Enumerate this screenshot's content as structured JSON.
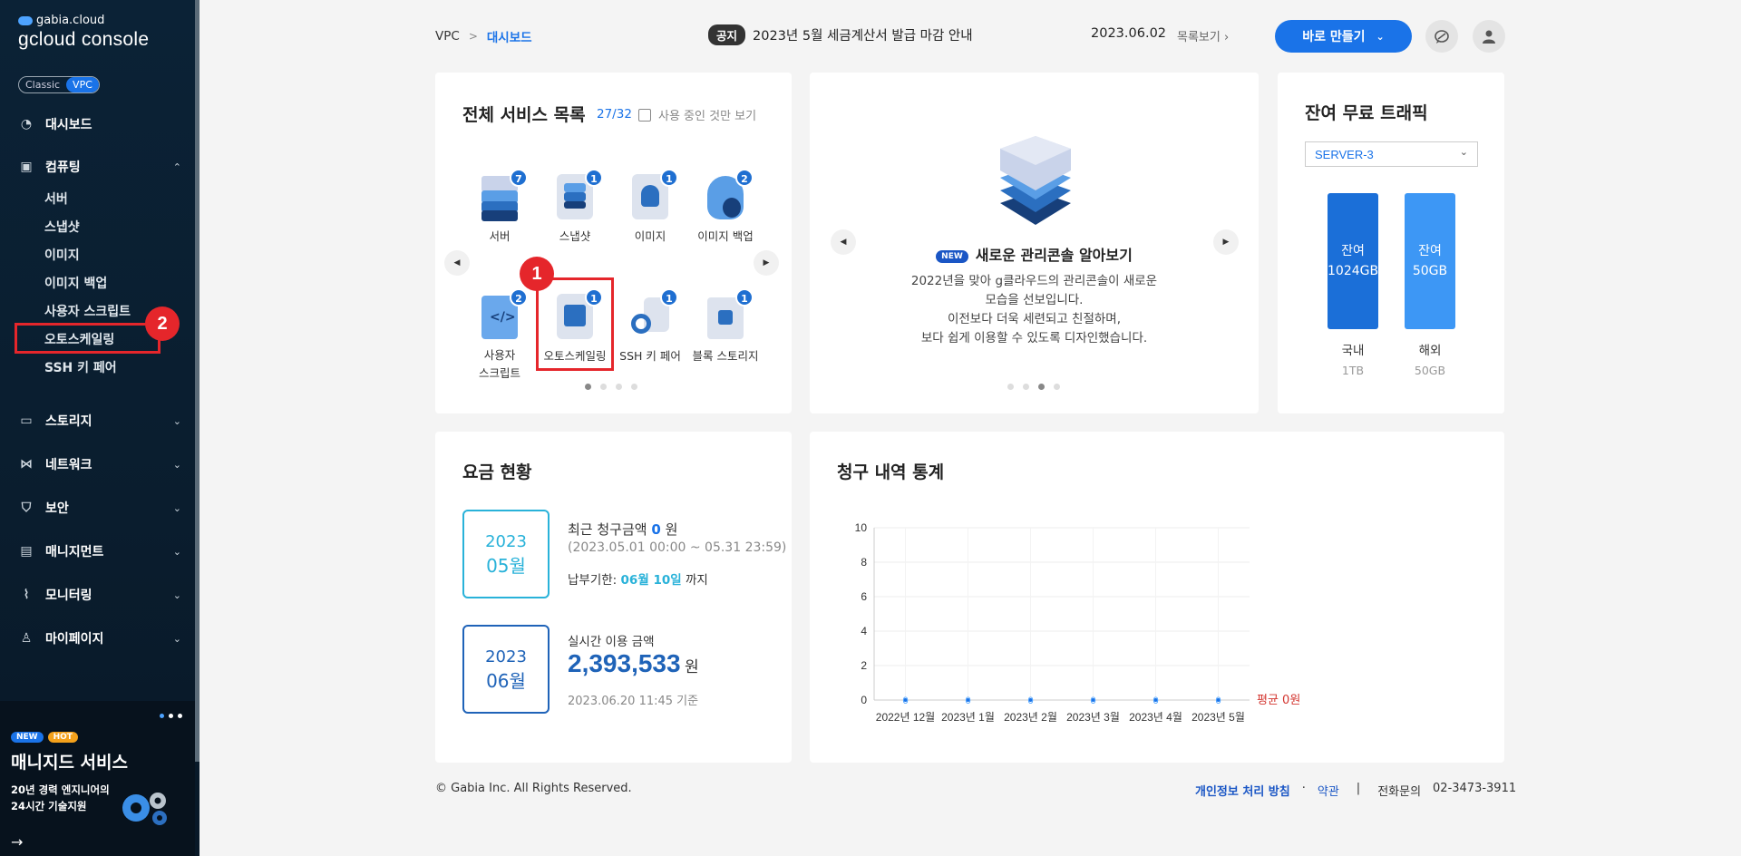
{
  "sidebar": {
    "brand": "gabia.cloud",
    "title": "gcloud console",
    "toggle": {
      "classic": "Classic",
      "vpc": "VPC"
    },
    "dashboard": "대시보드",
    "computing": {
      "label": "컴퓨팅",
      "items": [
        "서버",
        "스냅샷",
        "이미지",
        "이미지 백업",
        "사용자 스크립트",
        "오토스케일링",
        "SSH 키 페어"
      ]
    },
    "menus": [
      "스토리지",
      "네트워크",
      "보안",
      "매니지먼트",
      "모니터링",
      "마이페이지"
    ],
    "promo": {
      "tag_new": "NEW",
      "tag_hot": "HOT",
      "title": "매니지드 서비스",
      "line1": "20년 경력 엔지니어의",
      "line2": "24시간 기술지원"
    }
  },
  "annotations": {
    "step1": "1",
    "step2": "2"
  },
  "header": {
    "crumb_root": "VPC",
    "crumb_sep": ">",
    "crumb_current": "대시보드",
    "notice_tag": "공지",
    "notice_text": "2023년 5월 세금계산서 발급 마감 안내",
    "notice_date": "2023.06.02",
    "notice_more": "목록보기",
    "create_button": "바로 만들기"
  },
  "services": {
    "title": "전체 서비스 목록",
    "count": "27/32",
    "filter_label": "사용 중인 것만 보기",
    "items": [
      {
        "label": "서버",
        "count": "7"
      },
      {
        "label": "스냅샷",
        "count": "1"
      },
      {
        "label": "이미지",
        "count": "1"
      },
      {
        "label": "이미지 백업",
        "count": "2"
      },
      {
        "label": "사용자\n스크립트",
        "count": "2"
      },
      {
        "label": "오토스케일링",
        "count": "1"
      },
      {
        "label": "SSH 키 페어",
        "count": "1"
      },
      {
        "label": "블록 스토리지",
        "count": "1"
      }
    ]
  },
  "slide": {
    "new_tag": "NEW",
    "title": "새로운 관리콘솔 알아보기",
    "desc1": "2022년을 맞아 g클라우드의 관리콘솔이 새로운",
    "desc2": "모습을 선보입니다.",
    "desc3": "이전보다 더욱 세련되고 친절하며,",
    "desc4": "보다 쉽게 이용할 수 있도록 디자인했습니다."
  },
  "traffic": {
    "title": "잔여 무료 트래픽",
    "server": "SERVER-3",
    "domestic": {
      "bar_top": "잔여",
      "bar_value": "1024GB",
      "label": "국내",
      "total": "1TB"
    },
    "overseas": {
      "bar_top": "잔여",
      "bar_value": "50GB",
      "label": "해외",
      "total": "50GB"
    }
  },
  "billing": {
    "title": "요금 현황",
    "box1": {
      "year": "2023",
      "month": "05월"
    },
    "box2": {
      "year": "2023",
      "month": "06월"
    },
    "recent_label": "최근 청구금액",
    "recent_amount": "0",
    "won": "원",
    "period": "(2023.05.01 00:00 ~ 05.31 23:59)",
    "due_label": "납부기한:",
    "due_date": "06월 10일",
    "due_suffix": "까지",
    "realtime_label": "실시간 이용 금액",
    "realtime_amount": "2,393,533",
    "realtime_basis": "2023.06.20 11:45 기준"
  },
  "chart_data": {
    "type": "line",
    "title": "청구 내역 통계",
    "categories": [
      "2022년 12월",
      "2023년 1월",
      "2023년 2월",
      "2023년 3월",
      "2023년 4월",
      "2023년 5월"
    ],
    "values": [
      0,
      0,
      0,
      0,
      0,
      0
    ],
    "yticks": [
      0,
      2,
      4,
      6,
      8,
      10
    ],
    "ylim": [
      0,
      10
    ],
    "average_label": "평균 0원",
    "grid": true
  },
  "footer": {
    "copyright": "© Gabia Inc. All Rights Reserved.",
    "privacy": "개인정보 처리 방침",
    "dot": "·",
    "terms": "약관",
    "bar": "|",
    "phone_label": "전화문의",
    "phone": "02-3473-3911"
  },
  "colors": {
    "accent": "#1a73e8",
    "highlight": "#e5262b",
    "bar_domestic": "#1b6fd8",
    "bar_overseas": "#3d97f5"
  }
}
